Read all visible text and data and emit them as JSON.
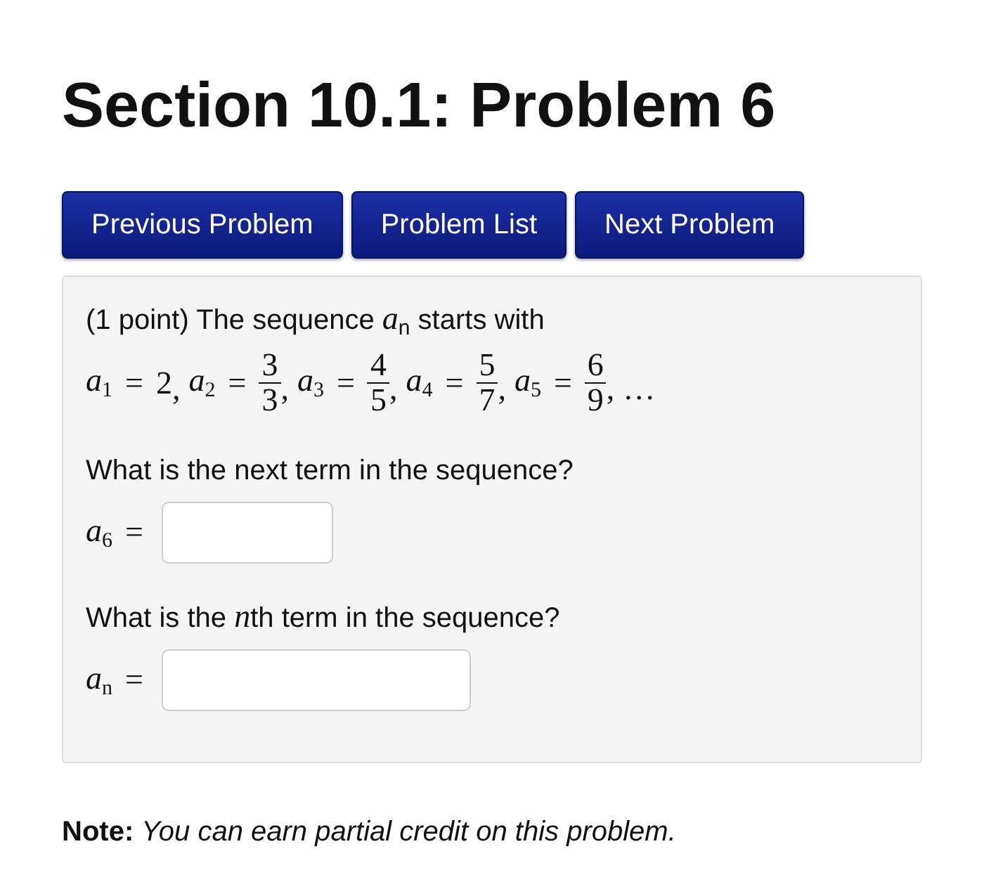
{
  "title": "Section 10.1: Problem 6",
  "nav_buttons": [
    "Previous Problem",
    "Problem List",
    "Next Problem"
  ],
  "problem": {
    "intro": "(1 point) The sequence *a*$_{n}$  starts with",
    "terms": [
      {
        "kind": "number",
        "lhs": "a",
        "sub": "1",
        "rel": "=",
        "value": "2",
        "sep": ","
      },
      {
        "kind": "fraction",
        "lhs": "a",
        "sub": "2",
        "rel": "=",
        "num": "3",
        "den": "3",
        "sep": ","
      },
      {
        "kind": "fraction",
        "lhs": "a",
        "sub": "3",
        "rel": "=",
        "num": "4",
        "den": "5",
        "sep": ","
      },
      {
        "kind": "fraction",
        "lhs": "a",
        "sub": "4",
        "rel": "=",
        "num": "5",
        "den": "7",
        "sep": ","
      },
      {
        "kind": "fraction",
        "lhs": "a",
        "sub": "5",
        "rel": "=",
        "num": "6",
        "den": "9",
        "sep": ","
      }
    ],
    "tail": "…",
    "questions": [
      {
        "text": [
          "What is the next term in the sequence?"
        ],
        "lhs": "a",
        "sub": "6",
        "rel": "=",
        "kind": "short"
      },
      {
        "text": [
          "What is the ",
          "*n*",
          "th term in the sequence?"
        ],
        "lhs": "a",
        "sub": "n",
        "rel": "=",
        "kind": "long"
      }
    ]
  },
  "note": "**Note:** *You can earn partial credit on this problem.*"
}
